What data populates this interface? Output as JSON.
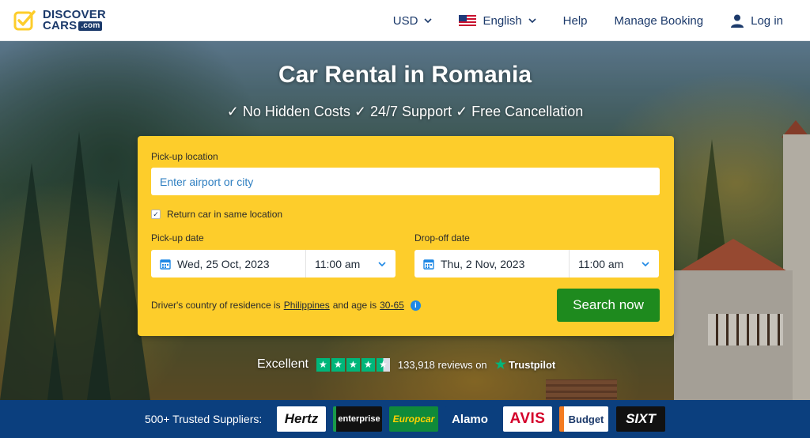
{
  "header": {
    "logo_line1": "DISCOVER",
    "logo_line2": "CARS",
    "logo_com": ".com",
    "currency": "USD",
    "language": "English",
    "help": "Help",
    "manage_booking": "Manage Booking",
    "login": "Log in"
  },
  "hero": {
    "title": "Car Rental in Romania",
    "subtitle": "✓ No Hidden Costs ✓ 24/7 Support ✓ Free Cancellation"
  },
  "search": {
    "pickup_location_label": "Pick-up location",
    "pickup_location_placeholder": "Enter airport or city",
    "return_same_label": "Return car in same location",
    "return_same_checked": true,
    "pickup_date_label": "Pick-up date",
    "pickup_date": "Wed, 25 Oct, 2023",
    "pickup_time": "11:00 am",
    "dropoff_date_label": "Drop-off date",
    "dropoff_date": "Thu, 2 Nov, 2023",
    "dropoff_time": "11:00 am",
    "residence_prefix": "Driver's country of residence is",
    "residence_country": "Philippines",
    "age_prefix": "and age is",
    "age_range": "30-65",
    "search_button": "Search now"
  },
  "trustpilot": {
    "rating_word": "Excellent",
    "reviews_text": "133,918 reviews on",
    "brand": "Trustpilot",
    "stars": 4.5
  },
  "suppliers": {
    "label": "500+ Trusted Suppliers:",
    "logos": [
      "Hertz",
      "enterprise",
      "Europcar",
      "Alamo",
      "AVIS",
      "Budget",
      "SIXT"
    ]
  },
  "colors": {
    "brand_navy": "#1c3a6b",
    "brand_yellow": "#fdcd2b",
    "search_green": "#1e8a1e",
    "supplier_bar": "#0b3f7e",
    "trustpilot_green": "#00b67a"
  }
}
